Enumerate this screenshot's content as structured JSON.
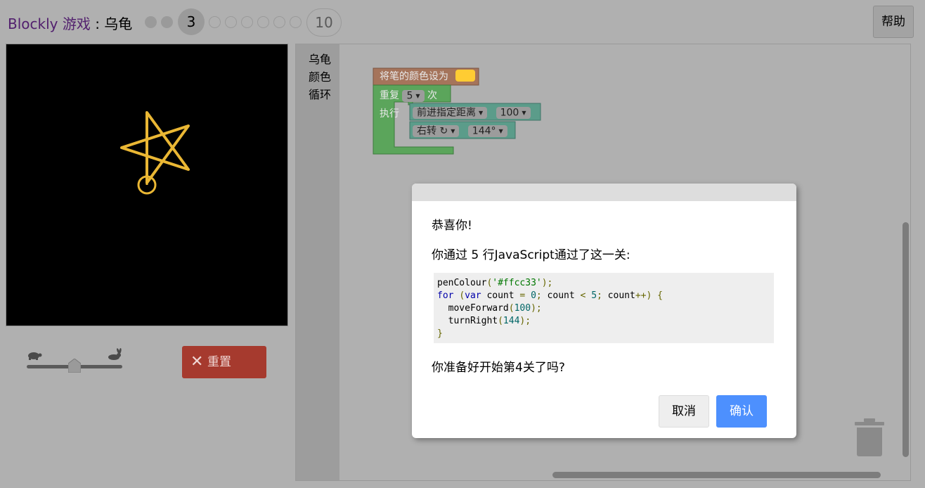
{
  "header": {
    "app_link": "Blockly 游戏",
    "separator": " : ",
    "game_name": "乌龟",
    "current_level": "3",
    "last_level": "10",
    "help_label": "帮助"
  },
  "controls": {
    "reset_label": "重置",
    "speed": 0.5
  },
  "toolbox": {
    "items": [
      "乌龟",
      "颜色",
      "循环"
    ]
  },
  "blocks": {
    "pen_colour_label": "将笔的颜色设为",
    "pen_colour_value": "#ffcc33",
    "repeat_label": "重复",
    "repeat_count": "5",
    "repeat_suffix": "次",
    "do_label": "执行",
    "move_label": "前进指定距离",
    "move_value": "100",
    "turn_label": "右转 ↻",
    "turn_value": "144°"
  },
  "colors": {
    "turtle_color": "#eab734",
    "colour_block": "#a5745b",
    "loop_block": "#5ba55b",
    "turtle_block": "#5b9c8a"
  },
  "dialog": {
    "congrats": "恭喜你!",
    "lines_message": "你通过 5 行JavaScript通过了这一关:",
    "code_lines": [
      "penColour('#ffcc33');",
      "for (var count = 0; count < 5; count++) {",
      "  moveForward(100);",
      "  turnRight(144);",
      "}"
    ],
    "next_question": "你准备好开始第4关了吗?",
    "cancel_label": "取消",
    "ok_label": "确认"
  }
}
